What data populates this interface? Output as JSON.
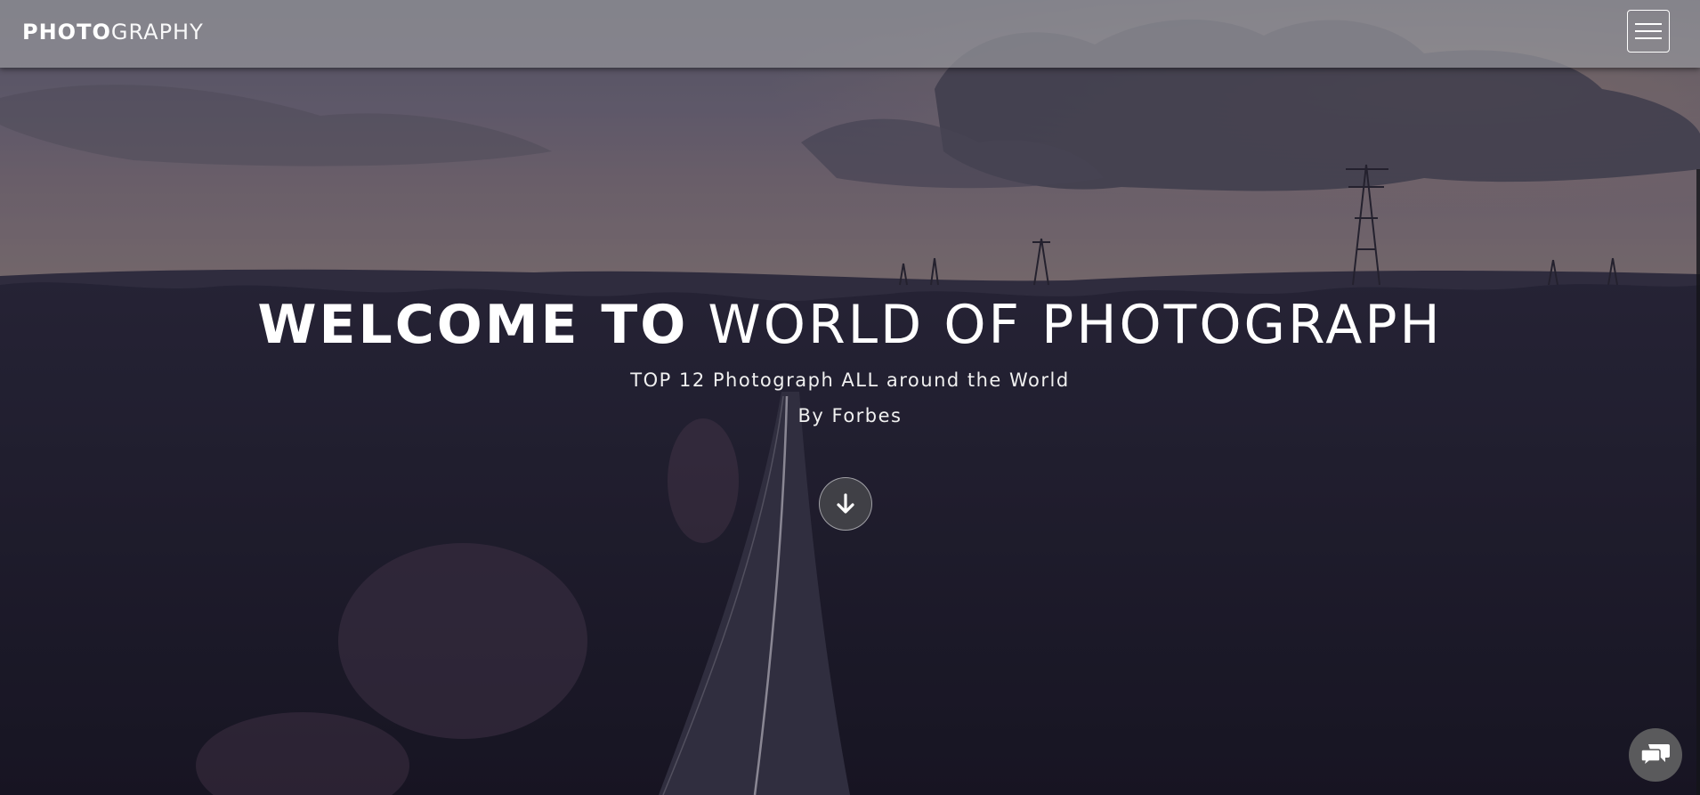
{
  "navbar": {
    "brand_bold": "PHOTO",
    "brand_light": "GRAPHY",
    "menu_icon": "hamburger-menu-icon"
  },
  "hero": {
    "title_strong": "WELCOME TO",
    "title_thin": "WORLD OF PHOTOGRAPH",
    "subtitle": "TOP 12 Photograph ALL around the World",
    "author": "By Forbes",
    "scroll_icon": "arrow-down-icon"
  },
  "chat": {
    "icon": "chat-bubbles-icon"
  },
  "colors": {
    "navbar_bg": "#969699",
    "text": "#ffffff",
    "chat_bg": "#5a5a5c"
  }
}
